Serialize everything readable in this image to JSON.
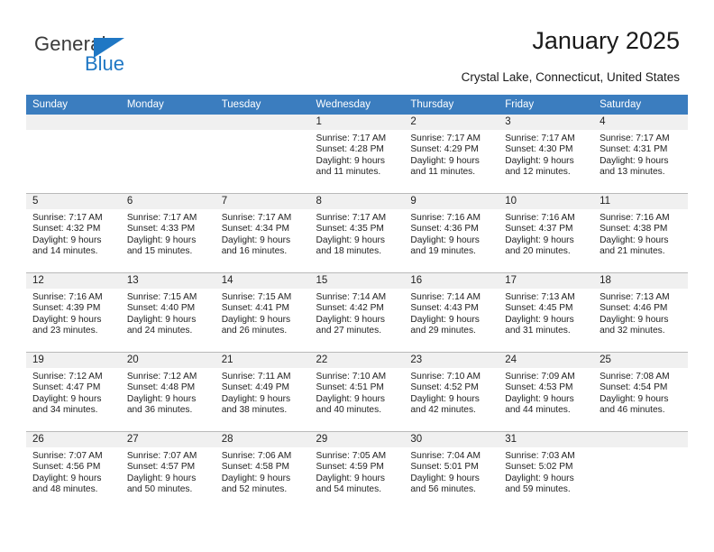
{
  "brand": {
    "name_top": "General",
    "name_bottom": "Blue",
    "accent_color": "#1f77c4"
  },
  "header": {
    "title": "January 2025",
    "subtitle": "Crystal Lake, Connecticut, United States"
  },
  "calendar": {
    "header_color": "#3b7dbf",
    "daynum_band_color": "#f0f0f0",
    "weekday_headers": [
      "Sunday",
      "Monday",
      "Tuesday",
      "Wednesday",
      "Thursday",
      "Friday",
      "Saturday"
    ],
    "weeks": [
      [
        {
          "empty": true
        },
        {
          "empty": true
        },
        {
          "empty": true
        },
        {
          "day": "1",
          "sunrise": "Sunrise: 7:17 AM",
          "sunset": "Sunset: 4:28 PM",
          "daylight1": "Daylight: 9 hours",
          "daylight2": "and 11 minutes."
        },
        {
          "day": "2",
          "sunrise": "Sunrise: 7:17 AM",
          "sunset": "Sunset: 4:29 PM",
          "daylight1": "Daylight: 9 hours",
          "daylight2": "and 11 minutes."
        },
        {
          "day": "3",
          "sunrise": "Sunrise: 7:17 AM",
          "sunset": "Sunset: 4:30 PM",
          "daylight1": "Daylight: 9 hours",
          "daylight2": "and 12 minutes."
        },
        {
          "day": "4",
          "sunrise": "Sunrise: 7:17 AM",
          "sunset": "Sunset: 4:31 PM",
          "daylight1": "Daylight: 9 hours",
          "daylight2": "and 13 minutes."
        }
      ],
      [
        {
          "day": "5",
          "sunrise": "Sunrise: 7:17 AM",
          "sunset": "Sunset: 4:32 PM",
          "daylight1": "Daylight: 9 hours",
          "daylight2": "and 14 minutes."
        },
        {
          "day": "6",
          "sunrise": "Sunrise: 7:17 AM",
          "sunset": "Sunset: 4:33 PM",
          "daylight1": "Daylight: 9 hours",
          "daylight2": "and 15 minutes."
        },
        {
          "day": "7",
          "sunrise": "Sunrise: 7:17 AM",
          "sunset": "Sunset: 4:34 PM",
          "daylight1": "Daylight: 9 hours",
          "daylight2": "and 16 minutes."
        },
        {
          "day": "8",
          "sunrise": "Sunrise: 7:17 AM",
          "sunset": "Sunset: 4:35 PM",
          "daylight1": "Daylight: 9 hours",
          "daylight2": "and 18 minutes."
        },
        {
          "day": "9",
          "sunrise": "Sunrise: 7:16 AM",
          "sunset": "Sunset: 4:36 PM",
          "daylight1": "Daylight: 9 hours",
          "daylight2": "and 19 minutes."
        },
        {
          "day": "10",
          "sunrise": "Sunrise: 7:16 AM",
          "sunset": "Sunset: 4:37 PM",
          "daylight1": "Daylight: 9 hours",
          "daylight2": "and 20 minutes."
        },
        {
          "day": "11",
          "sunrise": "Sunrise: 7:16 AM",
          "sunset": "Sunset: 4:38 PM",
          "daylight1": "Daylight: 9 hours",
          "daylight2": "and 21 minutes."
        }
      ],
      [
        {
          "day": "12",
          "sunrise": "Sunrise: 7:16 AM",
          "sunset": "Sunset: 4:39 PM",
          "daylight1": "Daylight: 9 hours",
          "daylight2": "and 23 minutes."
        },
        {
          "day": "13",
          "sunrise": "Sunrise: 7:15 AM",
          "sunset": "Sunset: 4:40 PM",
          "daylight1": "Daylight: 9 hours",
          "daylight2": "and 24 minutes."
        },
        {
          "day": "14",
          "sunrise": "Sunrise: 7:15 AM",
          "sunset": "Sunset: 4:41 PM",
          "daylight1": "Daylight: 9 hours",
          "daylight2": "and 26 minutes."
        },
        {
          "day": "15",
          "sunrise": "Sunrise: 7:14 AM",
          "sunset": "Sunset: 4:42 PM",
          "daylight1": "Daylight: 9 hours",
          "daylight2": "and 27 minutes."
        },
        {
          "day": "16",
          "sunrise": "Sunrise: 7:14 AM",
          "sunset": "Sunset: 4:43 PM",
          "daylight1": "Daylight: 9 hours",
          "daylight2": "and 29 minutes."
        },
        {
          "day": "17",
          "sunrise": "Sunrise: 7:13 AM",
          "sunset": "Sunset: 4:45 PM",
          "daylight1": "Daylight: 9 hours",
          "daylight2": "and 31 minutes."
        },
        {
          "day": "18",
          "sunrise": "Sunrise: 7:13 AM",
          "sunset": "Sunset: 4:46 PM",
          "daylight1": "Daylight: 9 hours",
          "daylight2": "and 32 minutes."
        }
      ],
      [
        {
          "day": "19",
          "sunrise": "Sunrise: 7:12 AM",
          "sunset": "Sunset: 4:47 PM",
          "daylight1": "Daylight: 9 hours",
          "daylight2": "and 34 minutes."
        },
        {
          "day": "20",
          "sunrise": "Sunrise: 7:12 AM",
          "sunset": "Sunset: 4:48 PM",
          "daylight1": "Daylight: 9 hours",
          "daylight2": "and 36 minutes."
        },
        {
          "day": "21",
          "sunrise": "Sunrise: 7:11 AM",
          "sunset": "Sunset: 4:49 PM",
          "daylight1": "Daylight: 9 hours",
          "daylight2": "and 38 minutes."
        },
        {
          "day": "22",
          "sunrise": "Sunrise: 7:10 AM",
          "sunset": "Sunset: 4:51 PM",
          "daylight1": "Daylight: 9 hours",
          "daylight2": "and 40 minutes."
        },
        {
          "day": "23",
          "sunrise": "Sunrise: 7:10 AM",
          "sunset": "Sunset: 4:52 PM",
          "daylight1": "Daylight: 9 hours",
          "daylight2": "and 42 minutes."
        },
        {
          "day": "24",
          "sunrise": "Sunrise: 7:09 AM",
          "sunset": "Sunset: 4:53 PM",
          "daylight1": "Daylight: 9 hours",
          "daylight2": "and 44 minutes."
        },
        {
          "day": "25",
          "sunrise": "Sunrise: 7:08 AM",
          "sunset": "Sunset: 4:54 PM",
          "daylight1": "Daylight: 9 hours",
          "daylight2": "and 46 minutes."
        }
      ],
      [
        {
          "day": "26",
          "sunrise": "Sunrise: 7:07 AM",
          "sunset": "Sunset: 4:56 PM",
          "daylight1": "Daylight: 9 hours",
          "daylight2": "and 48 minutes."
        },
        {
          "day": "27",
          "sunrise": "Sunrise: 7:07 AM",
          "sunset": "Sunset: 4:57 PM",
          "daylight1": "Daylight: 9 hours",
          "daylight2": "and 50 minutes."
        },
        {
          "day": "28",
          "sunrise": "Sunrise: 7:06 AM",
          "sunset": "Sunset: 4:58 PM",
          "daylight1": "Daylight: 9 hours",
          "daylight2": "and 52 minutes."
        },
        {
          "day": "29",
          "sunrise": "Sunrise: 7:05 AM",
          "sunset": "Sunset: 4:59 PM",
          "daylight1": "Daylight: 9 hours",
          "daylight2": "and 54 minutes."
        },
        {
          "day": "30",
          "sunrise": "Sunrise: 7:04 AM",
          "sunset": "Sunset: 5:01 PM",
          "daylight1": "Daylight: 9 hours",
          "daylight2": "and 56 minutes."
        },
        {
          "day": "31",
          "sunrise": "Sunrise: 7:03 AM",
          "sunset": "Sunset: 5:02 PM",
          "daylight1": "Daylight: 9 hours",
          "daylight2": "and 59 minutes."
        },
        {
          "empty": true
        }
      ]
    ]
  }
}
